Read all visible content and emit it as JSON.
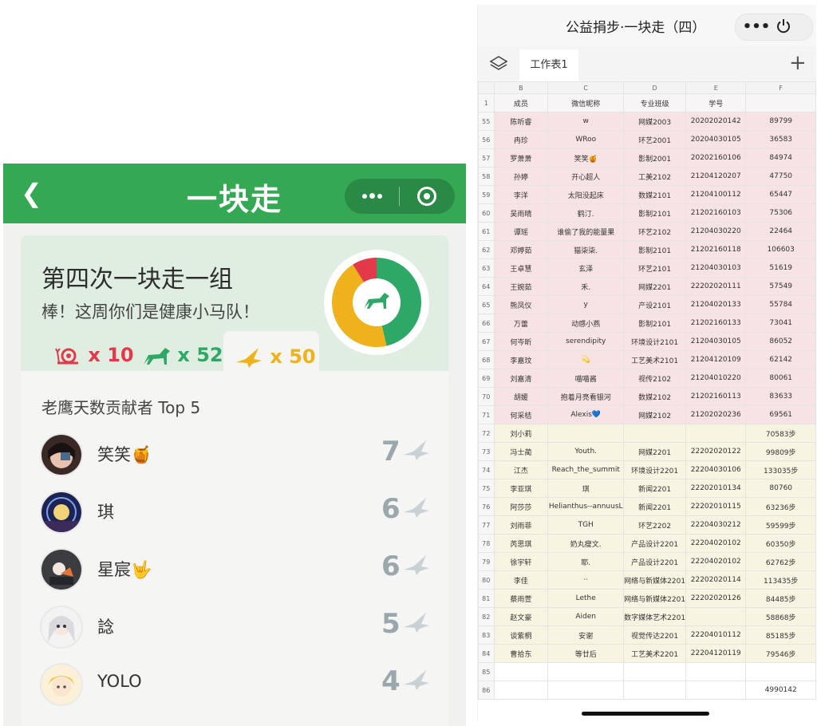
{
  "left": {
    "title": "一块走",
    "team": {
      "name": "第四次一块走一组",
      "message": "棒！这周你们是健康小马队！",
      "stats": [
        {
          "icon": "snail-icon",
          "label": "x 10",
          "value": 10,
          "color": "#e23a4a"
        },
        {
          "icon": "horse-icon",
          "label": "x 52",
          "value": 52,
          "color": "#2ea866"
        },
        {
          "icon": "eagle-icon",
          "label": "x 50",
          "value": 50,
          "color": "#efb21c"
        }
      ]
    },
    "ranking": {
      "title": "老鹰天数贡献者 Top 5",
      "items": [
        {
          "name": "笑笑🍯",
          "count": "7"
        },
        {
          "name": "琪",
          "count": "6"
        },
        {
          "name": "星宸🤟",
          "count": "6"
        },
        {
          "name": "諗",
          "count": "5"
        },
        {
          "name": "YOLO",
          "count": "4"
        }
      ]
    },
    "colors": {
      "brand": "#34a853",
      "snail": "#e23a4a",
      "horse": "#2ea866",
      "eagle": "#efb21c"
    }
  },
  "right": {
    "title": "公益捐步·一块走（四）",
    "more_label": "•••",
    "sheet_tab": "工作表1",
    "add_label": "+",
    "columns": [
      "B",
      "C",
      "D",
      "E",
      "F"
    ],
    "header_row": {
      "num": "1",
      "cells": [
        "成员",
        "微信昵称",
        "专业班级",
        "学号",
        ""
      ]
    },
    "rows": [
      {
        "num": "55",
        "style": "pink",
        "cells": [
          "陈听睿",
          "w",
          "网媒2003",
          "20202020142",
          "89799"
        ]
      },
      {
        "num": "56",
        "style": "pink",
        "cells": [
          "冉珍",
          "WRoo",
          "环艺2001",
          "20204030105",
          "36583"
        ]
      },
      {
        "num": "57",
        "style": "pink",
        "cells": [
          "罗萧萧",
          "笑笑🍯",
          "影制2001",
          "20202160106",
          "84974"
        ]
      },
      {
        "num": "58",
        "style": "pink",
        "cells": [
          "孙婷",
          "开心超人",
          "工美2102",
          "21204120207",
          "47750"
        ]
      },
      {
        "num": "59",
        "style": "pink",
        "cells": [
          "李洋",
          "太阳没起床",
          "数媒2101",
          "21204100112",
          "65447"
        ]
      },
      {
        "num": "60",
        "style": "pink",
        "cells": [
          "吴雨晴",
          "鹤汀.",
          "影制2101",
          "21202160103",
          "75306"
        ]
      },
      {
        "num": "61",
        "style": "pink",
        "cells": [
          "谭瑶",
          "谁偷了我的能量果",
          "环艺2102",
          "21204030220",
          "22464"
        ]
      },
      {
        "num": "62",
        "style": "pink",
        "cells": [
          "邓婷茹",
          "猫柒柒.",
          "影制2101",
          "21202160118",
          "106603"
        ]
      },
      {
        "num": "63",
        "style": "pink",
        "cells": [
          "王卓慧",
          "玄泽",
          "环艺2101",
          "21204030103",
          "51619"
        ]
      },
      {
        "num": "64",
        "style": "pink",
        "cells": [
          "王婉茹",
          "禾.",
          "网媒2201",
          "22202020111",
          "57549"
        ]
      },
      {
        "num": "65",
        "style": "pink",
        "cells": [
          "熊凤仪",
          "y",
          "产设2101",
          "21204020133",
          "55784"
        ]
      },
      {
        "num": "66",
        "style": "pink",
        "cells": [
          "万蕾",
          "动感小燕",
          "影制2101",
          "21202160133",
          "73041"
        ]
      },
      {
        "num": "67",
        "style": "pink",
        "cells": [
          "何岑昕",
          "serendipity",
          "环境设计2101",
          "21204030105",
          "86052"
        ]
      },
      {
        "num": "68",
        "style": "pink",
        "cells": [
          "李嘉玟",
          "💫",
          "工艺美术2101",
          "21204120109",
          "62142"
        ]
      },
      {
        "num": "69",
        "style": "pink",
        "cells": [
          "刘嘉清",
          "喵喵酱",
          "视传2102",
          "21204010220",
          "80061"
        ]
      },
      {
        "num": "70",
        "style": "pink",
        "cells": [
          "胡媛",
          "抱着月亮看银河",
          "数媒2102",
          "21202160113",
          "83633"
        ]
      },
      {
        "num": "71",
        "style": "pink",
        "cells": [
          "何采桔",
          "Alexis💙",
          "网媒2102",
          "21202020236",
          "69561"
        ]
      },
      {
        "num": "72",
        "style": "yel",
        "cells": [
          "刘小莉",
          "",
          "",
          "",
          "70583步"
        ]
      },
      {
        "num": "73",
        "style": "yel",
        "cells": [
          "冯士蔺",
          "Youth.",
          "网媒2201",
          "22202020122",
          "99809步"
        ]
      },
      {
        "num": "74",
        "style": "yel",
        "cells": [
          "江杰",
          "Reach_the_summit",
          "环境设计2201",
          "22204030106",
          "133035步"
        ]
      },
      {
        "num": "75",
        "style": "yel",
        "cells": [
          "李亚琪",
          "琪",
          "新闻2201",
          "22202010134",
          "80760"
        ]
      },
      {
        "num": "76",
        "style": "yel",
        "cells": [
          "阿莎莎",
          "Helianthus--annuusL",
          "新闻2201",
          "22202010115",
          "63236步"
        ]
      },
      {
        "num": "77",
        "style": "yel",
        "cells": [
          "刘雨菲",
          "TGH",
          "环艺2202",
          "22204030212",
          "59599步"
        ]
      },
      {
        "num": "78",
        "style": "yel",
        "cells": [
          "芮思琪",
          "奶丸瘦文.",
          "产品设计2201",
          "22204020102",
          "60350步"
        ]
      },
      {
        "num": "79",
        "style": "yel",
        "cells": [
          "徐宇轩",
          "耶.",
          "产品设计2201",
          "22204020102",
          "62762步"
        ]
      },
      {
        "num": "80",
        "style": "yel",
        "cells": [
          "李佳",
          "··",
          "网络与新媒体2201",
          "22202020114",
          "113435步"
        ]
      },
      {
        "num": "81",
        "style": "yel",
        "cells": [
          "蔡雨萱",
          "Lethe",
          "网络与新媒体2201",
          "22202020126",
          "84485步"
        ]
      },
      {
        "num": "82",
        "style": "yel",
        "cells": [
          "赵文豪",
          "Aiden",
          "数字媒体艺术2201",
          "",
          "58868步"
        ]
      },
      {
        "num": "83",
        "style": "yel",
        "cells": [
          "谈紫桐",
          "安谢",
          "视觉传达2201",
          "22204010112",
          "85185步"
        ]
      },
      {
        "num": "84",
        "style": "yel",
        "cells": [
          "曹拾东",
          "等廿后",
          "工艺美术2201",
          "22204120119",
          "79546步"
        ]
      },
      {
        "num": "85",
        "style": "plain",
        "cells": [
          "",
          "",
          "",
          "",
          ""
        ]
      },
      {
        "num": "86",
        "style": "plain",
        "cells": [
          "",
          "",
          "",
          "",
          "4990142"
        ]
      }
    ]
  }
}
